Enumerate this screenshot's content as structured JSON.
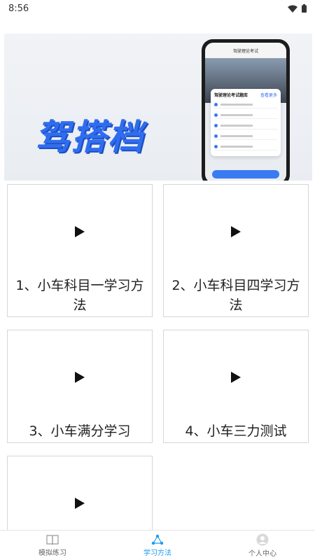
{
  "status_bar": {
    "time": "8:56"
  },
  "banner": {
    "title": "驾搭档",
    "phone_header": "驾驶理论考试",
    "phone_card_title": "驾驶理论考试题库",
    "phone_card_link": "查看更多"
  },
  "courses": [
    {
      "label": "1、小车科目一学习方法"
    },
    {
      "label": "2、小车科目四学习方法"
    },
    {
      "label": "3、小车满分学习"
    },
    {
      "label": "4、小车三力测试"
    },
    {
      "label": ""
    }
  ],
  "tabbar": {
    "items": [
      {
        "label": "模拟练习",
        "icon": "book-icon"
      },
      {
        "label": "学习方法",
        "icon": "network-icon",
        "active": true
      },
      {
        "label": "个人中心",
        "icon": "person-icon"
      }
    ]
  },
  "colors": {
    "accent": "#1a9cf0",
    "brand": "#2f6df0"
  }
}
